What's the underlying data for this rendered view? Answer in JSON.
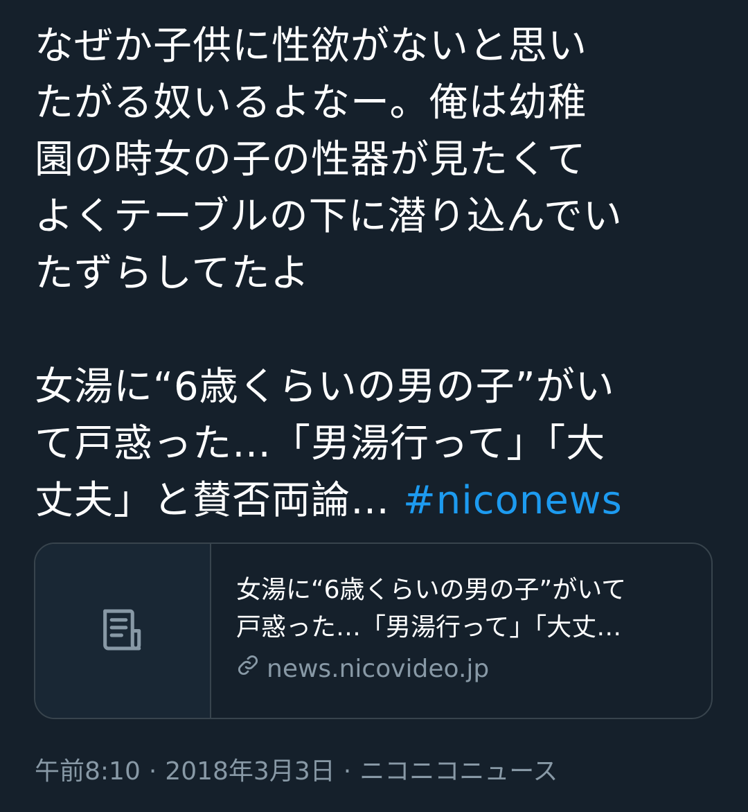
{
  "tweet": {
    "lines": [
      "なぜか子供に性欲がないと思い",
      "たがる奴いるよなー。俺は幼稚",
      "園の時女の子の性器が見たくて",
      "よくテーブルの下に潜り込んでい",
      "たずらしてたよ"
    ],
    "quote_lines": [
      "女湯に“6歳くらいの男の子”がい",
      "て戸惑った…「男湯行って」「大"
    ],
    "quote_last_line": "丈夫」と賛否両論… ",
    "hashtag": "#niconews"
  },
  "card": {
    "icon": "article-icon",
    "title_lines": [
      "女湯に“6歳くらいの男の子”がいて",
      "戸惑った…「男湯行って」「大丈…"
    ],
    "link_icon": "link-icon",
    "domain": "news.nicovideo.jp"
  },
  "meta": {
    "time": "午前8:10",
    "date": "2018年3月3日",
    "source": "ニコニコニュース",
    "separator": "·"
  },
  "colors": {
    "background": "#15202b",
    "text": "#ffffff",
    "secondary": "#8899a6",
    "link": "#1d9bf0",
    "border": "#38444d"
  }
}
